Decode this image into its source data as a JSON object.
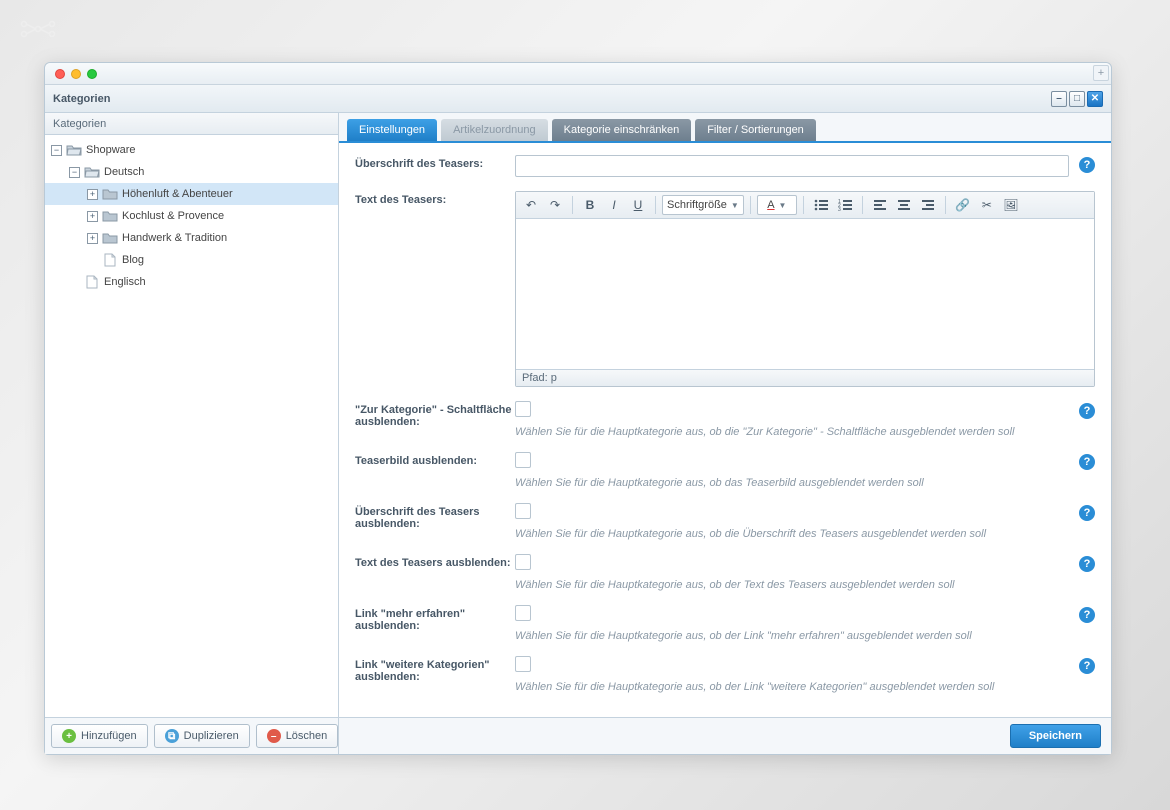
{
  "window": {
    "title": "Kategorien"
  },
  "sidebar": {
    "heading": "Kategorien",
    "tree": [
      {
        "label": "Shopware",
        "depth": 0,
        "expand": "−",
        "icon": "folder-open"
      },
      {
        "label": "Deutsch",
        "depth": 1,
        "expand": "−",
        "icon": "folder-open"
      },
      {
        "label": "Höhenluft & Abenteuer",
        "depth": 2,
        "expand": "+",
        "icon": "folder",
        "selected": true
      },
      {
        "label": "Kochlust & Provence",
        "depth": 2,
        "expand": "+",
        "icon": "folder"
      },
      {
        "label": "Handwerk & Tradition",
        "depth": 2,
        "expand": "+",
        "icon": "folder"
      },
      {
        "label": "Blog",
        "depth": 2,
        "expand": "",
        "icon": "file"
      },
      {
        "label": "Englisch",
        "depth": 1,
        "expand": "",
        "icon": "file"
      }
    ],
    "buttons": {
      "add": "Hinzufügen",
      "duplicate": "Duplizieren",
      "delete": "Löschen"
    }
  },
  "tabs": [
    {
      "label": "Einstellungen",
      "state": "active"
    },
    {
      "label": "Artikelzuordnung",
      "state": "disabled"
    },
    {
      "label": "Kategorie einschränken",
      "state": ""
    },
    {
      "label": "Filter / Sortierungen",
      "state": ""
    }
  ],
  "editor": {
    "font_size_label": "Schriftgröße",
    "path_label": "Pfad: p"
  },
  "form": {
    "teaser_heading_label": "Überschrift des Teasers:",
    "teaser_text_label": "Text des Teasers:",
    "rows": [
      {
        "label": "\"Zur Kategorie\" - Schaltfläche ausblenden:",
        "hint": "Wählen Sie für die Hauptkategorie aus, ob die \"Zur Kategorie\" - Schaltfläche ausgeblendet werden soll"
      },
      {
        "label": "Teaserbild ausblenden:",
        "hint": "Wählen Sie für die Hauptkategorie aus, ob das Teaserbild ausgeblendet werden soll"
      },
      {
        "label": "Überschrift des Teasers ausblenden:",
        "hint": "Wählen Sie für die Hauptkategorie aus, ob die Überschrift des Teasers ausgeblendet werden soll"
      },
      {
        "label": "Text des Teasers ausblenden:",
        "hint": "Wählen Sie für die Hauptkategorie aus, ob der Text des Teasers ausgeblendet werden soll"
      },
      {
        "label": "Link \"mehr erfahren\" ausblenden:",
        "hint": "Wählen Sie für die Hauptkategorie aus, ob der Link \"mehr erfahren\" ausgeblendet werden soll"
      },
      {
        "label": "Link \"weitere Kategorien\" ausblenden:",
        "hint": "Wählen Sie für die Hauptkategorie aus, ob der Link \"weitere Kategorien\" ausgeblendet werden soll"
      }
    ]
  },
  "footer": {
    "save": "Speichern"
  }
}
